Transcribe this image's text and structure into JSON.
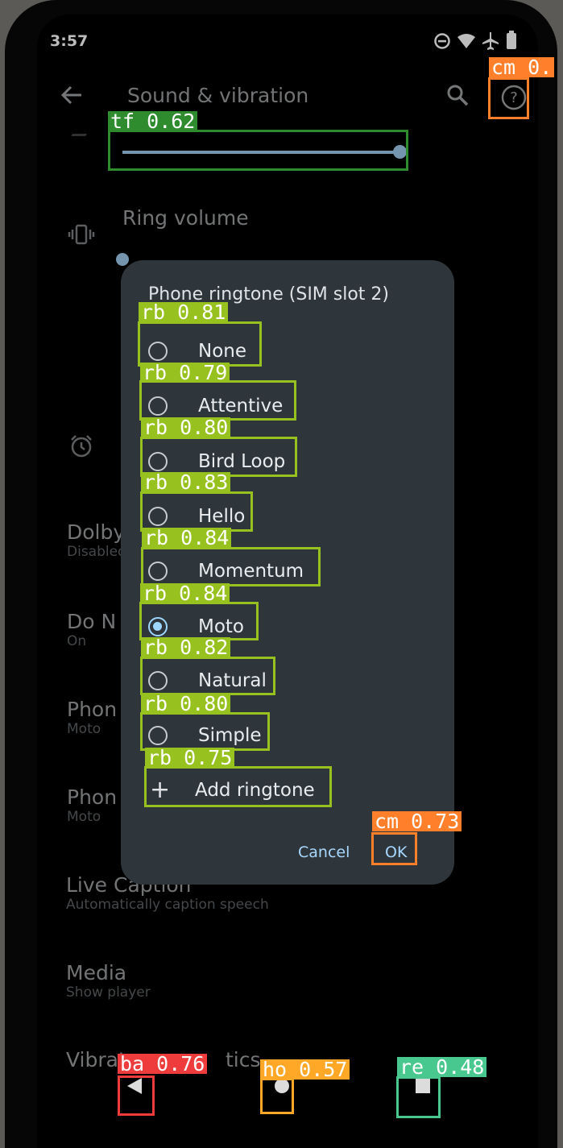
{
  "status_bar": {
    "time": "3:57"
  },
  "app_bar": {
    "title": "Sound & vibration"
  },
  "settings": {
    "ring_volume_label": "Ring volume",
    "items": [
      {
        "title": "Dolby",
        "subtitle": "Disabled"
      },
      {
        "title": "Do N",
        "subtitle": "On"
      },
      {
        "title": "Phon",
        "subtitle": "Moto"
      },
      {
        "title": "Phon",
        "subtitle": "Moto"
      },
      {
        "title": "Live Caption",
        "subtitle": "Automatically caption speech"
      },
      {
        "title": "Media",
        "subtitle": "Show player"
      },
      {
        "title": "Vibrat",
        "subtitle": ""
      },
      {
        "title": "tics",
        "subtitle": ""
      }
    ]
  },
  "slider": {
    "value_fraction": 1.0
  },
  "dialog": {
    "title": "Phone ringtone (SIM slot 2)",
    "options": [
      "None",
      "Attentive",
      "Bird Loop",
      "Hello",
      "Momentum",
      "Moto",
      "Natural",
      "Simple"
    ],
    "selected": "Moto",
    "add_label": "Add ringtone",
    "add_icon": "+",
    "cancel": "Cancel",
    "ok": "OK"
  },
  "detections": {
    "help": "cm  0.",
    "slider": "tf  0.62",
    "none": "rb  0.81",
    "attentive": "rb  0.79",
    "bird_loop": "rb  0.80",
    "hello": "rb  0.83",
    "momentum": "rb  0.84",
    "moto": "rb  0.84",
    "natural": "rb  0.82",
    "simple": "rb  0.80",
    "add": "rb  0.75",
    "ok": "cm  0.73",
    "back": "ba  0.76",
    "home": "ho  0.57",
    "recents": "re  0.48"
  },
  "colors": {
    "tf": "#2e8b2e",
    "rb": "#97c11f",
    "cm": "#ff7f2a",
    "ba": "#ee3b3b",
    "ho": "#ffa726",
    "re": "#48c78e",
    "accent": "#9fd6ff"
  },
  "icons": {
    "back": "arrow-left-icon",
    "search": "search-icon",
    "help": "help-circle-icon",
    "vibrate": "vibrate-icon",
    "alarm": "alarm-icon"
  }
}
